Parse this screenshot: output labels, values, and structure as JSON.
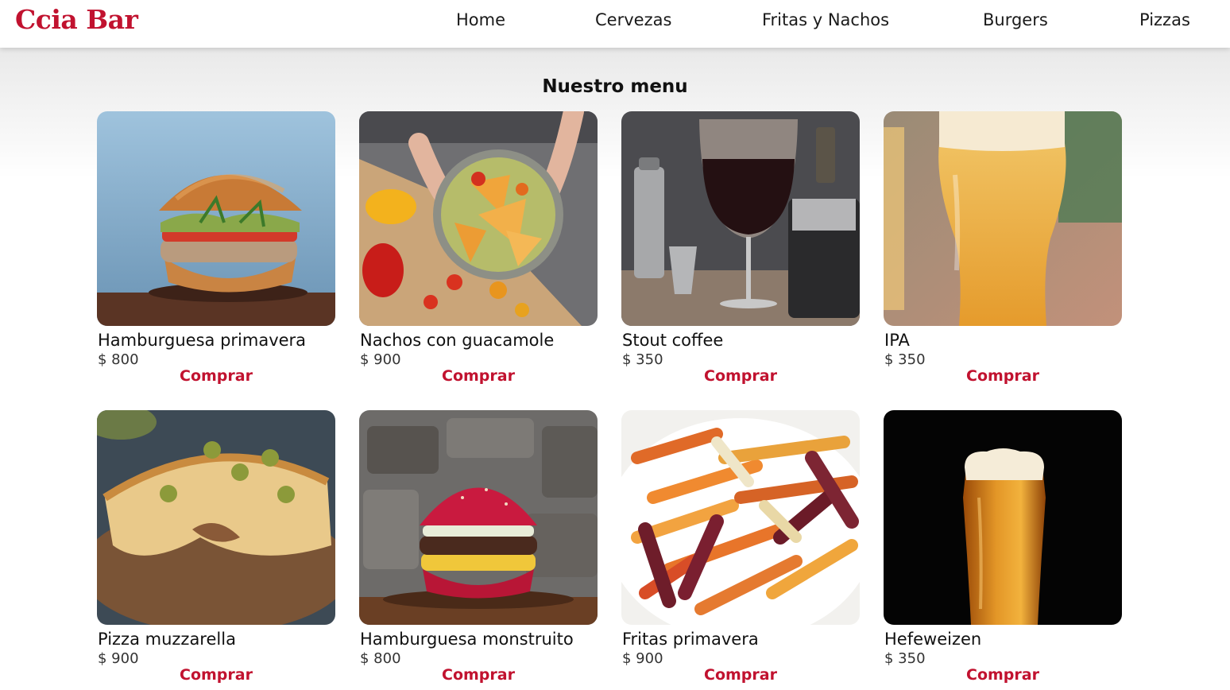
{
  "brand": {
    "name": "Ccia Bar",
    "color": "#c1122f"
  },
  "nav": {
    "home": "Home",
    "cervezas": "Cervezas",
    "fritas": "Fritas y Nachos",
    "burgers": "Burgers",
    "pizzas": "Pizzas"
  },
  "menu": {
    "title": "Nuestro menu",
    "buy_label": "Comprar",
    "items": [
      {
        "name": "Hamburguesa primavera",
        "price": "$ 800",
        "image": "burger-photo"
      },
      {
        "name": "Nachos con guacamole",
        "price": "$ 900",
        "image": "nachos-photo"
      },
      {
        "name": "Stout coffee",
        "price": "$ 350",
        "image": "stout-coffee-photo"
      },
      {
        "name": "IPA",
        "price": "$ 350",
        "image": "ipa-beer-photo"
      },
      {
        "name": "Pizza muzzarella",
        "price": "$ 900",
        "image": "pizza-photo"
      },
      {
        "name": "Hamburguesa monstruito",
        "price": "$ 800",
        "image": "red-burger-photo"
      },
      {
        "name": "Fritas primavera",
        "price": "$ 900",
        "image": "fries-photo"
      },
      {
        "name": "Hefeweizen",
        "price": "$ 350",
        "image": "hefeweizen-beer-photo"
      }
    ]
  }
}
